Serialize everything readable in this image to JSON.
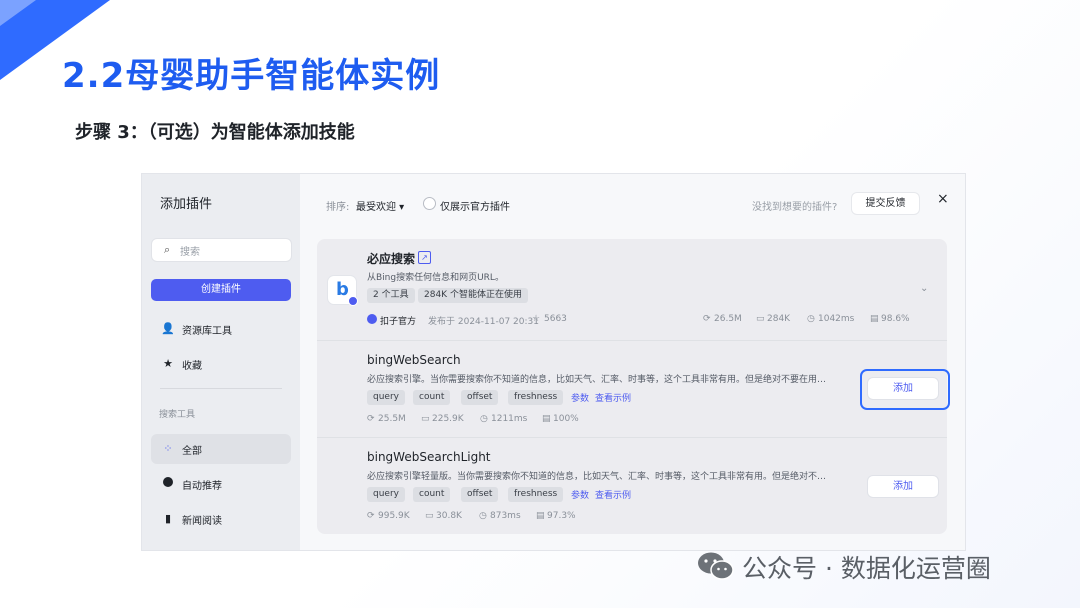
{
  "slide": {
    "title": "2.2母婴助手智能体实例",
    "subtitle": "步骤 3：（可选）为智能体添加技能"
  },
  "sidebar": {
    "header": "添加插件",
    "search_placeholder": "搜索",
    "create_label": "创建插件",
    "items": [
      {
        "icon": "person-icon",
        "label": "资源库工具"
      },
      {
        "icon": "star-icon",
        "label": "收藏"
      }
    ],
    "group_label": "搜索工具",
    "categories": [
      {
        "icon": "grid-icon",
        "label": "全部",
        "active": true
      },
      {
        "icon": "auto-recommend-icon",
        "label": "自动推荐"
      },
      {
        "icon": "newspaper-icon",
        "label": "新闻阅读"
      }
    ]
  },
  "toolbar": {
    "sort_label": "排序:",
    "sort_value": "最受欢迎 ▾",
    "official_only_label": "仅展示官方插件",
    "not_found_text": "没找到想要的插件?",
    "feedback_label": "提交反馈",
    "close_icon": "×"
  },
  "plugin": {
    "name": "必应搜索",
    "description": "从Bing搜索任何信息和网页URL。",
    "tags": [
      "2 个工具",
      "284K 个智能体正在使用"
    ],
    "author": "扣子官方",
    "published": "发布于 2024-11-07 20:31",
    "stars": "5663",
    "stats": {
      "calls": "26.5M",
      "bots": "284K",
      "latency": "1042ms",
      "success": "98.6%"
    }
  },
  "tools": [
    {
      "name": "bingWebSearch",
      "description": "必应搜索引擎。当你需要搜索你不知道的信息，比如天气、汇率、时事等，这个工具非常有用。但是绝对不要在用户想…",
      "params": [
        "query",
        "count",
        "offset",
        "freshness"
      ],
      "params_link": "参数",
      "example_link": "查看示例",
      "stats": {
        "calls": "25.5M",
        "bots": "225.9K",
        "latency": "1211ms",
        "success": "100%"
      },
      "add_label": "添加",
      "highlighted": true
    },
    {
      "name": "bingWebSearchLight",
      "description": "必应搜索引擎轻量版。当你需要搜索你不知道的信息，比如天气、汇率、时事等，这个工具非常有用。但是绝对不要在…",
      "params": [
        "query",
        "count",
        "offset",
        "freshness"
      ],
      "params_link": "参数",
      "example_link": "查看示例",
      "stats": {
        "calls": "995.9K",
        "bots": "30.8K",
        "latency": "873ms",
        "success": "97.3%"
      },
      "add_label": "添加",
      "highlighted": false
    }
  ],
  "watermark": "公众号 · 数据化运营圈",
  "colors": {
    "accent": "#4e5cf0",
    "title_blue": "#1e5cf0",
    "highlight": "#2f6bff"
  }
}
